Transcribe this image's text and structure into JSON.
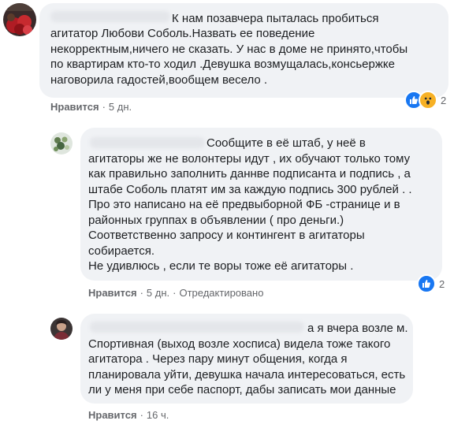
{
  "comments": [
    {
      "author": "",
      "lines": [
        "К нам позавчера пыталась пробиться",
        "агитатор Любови Соболь.Назвать ее поведение",
        "некорректным,ничего не сказать. У нас в доме не принято,чтобы",
        "по квартирам кто-то ходил .Девушка возмущалась,консьержке",
        "наговорила гадостей,вообщем весело ."
      ],
      "like_label": "Нравится",
      "separator": "·",
      "time": "5 дн.",
      "edited": "",
      "reactions": [
        "like-icon",
        "wow-icon"
      ],
      "reaction_count": "2"
    },
    {
      "author": "",
      "lines": [
        "Сообщите в её штаб, у неё в",
        "агитаторы же не волонтеры идут , их обучают только тому",
        "как правильно заполнить даннве подписанта и подпись , а",
        "штабе Соболь платят им за каждую подпись 300 рублей . .",
        "Про это написано на её предвыборной ФБ -странице и в",
        "районных группах в объявлении ( про деньги.)",
        "Соответственно запросу и контингент в агитаторы",
        "собирается.",
        "Не удивлюсь , если те воры тоже её агитаторы ."
      ],
      "like_label": "Нравится",
      "separator": "·",
      "time": "5 дн.",
      "edited": "Отредактировано",
      "reactions": [
        "like-icon"
      ],
      "reaction_count": "2"
    },
    {
      "author": "",
      "lines": [
        "а я вчера возле м.",
        "Спортивная (выход возле хосписа) видела тоже такого",
        "агитатора . Через пару минут общения, когда я",
        "планировала уйти, девушка начала интересоваться, есть",
        "ли у меня при себе паспорт, дабы записать мои данные"
      ],
      "like_label": "Нравится",
      "separator": "·",
      "time": "16 ч.",
      "edited": "",
      "reactions": [],
      "reaction_count": ""
    }
  ],
  "colors": {
    "bubble": "#f0f2f5",
    "text": "#1c1e21",
    "meta": "#65676b",
    "like_blue": "#1877f2",
    "wow_yellow": "#f7b125"
  }
}
